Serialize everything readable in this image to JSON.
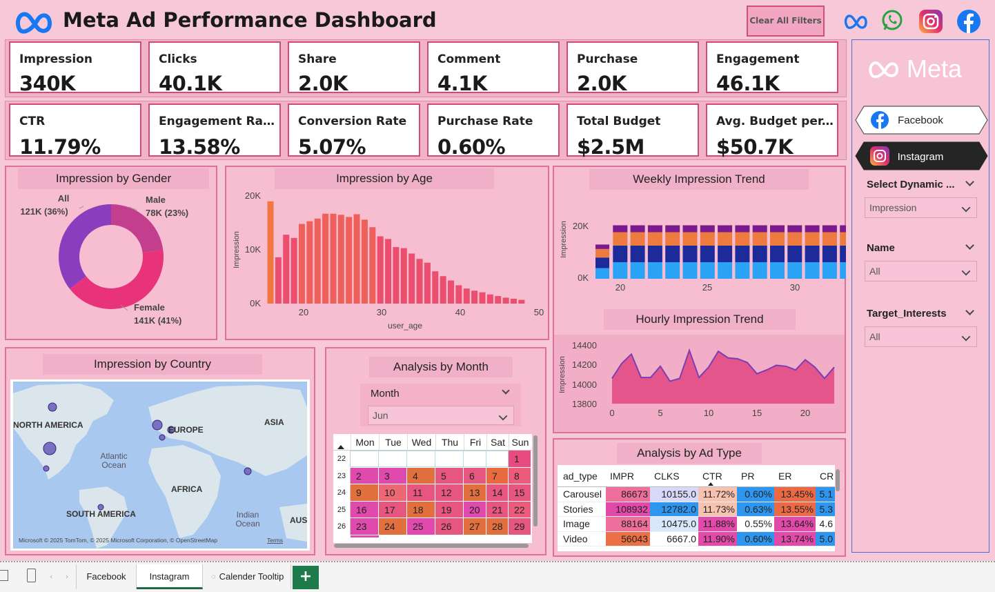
{
  "header": {
    "title": "Meta Ad Performance Dashboard",
    "clear_button": "Clear All Filters"
  },
  "kpis_row1": [
    {
      "label": "Impression",
      "value": "340K"
    },
    {
      "label": "Clicks",
      "value": "40.1K"
    },
    {
      "label": "Share",
      "value": "2.0K"
    },
    {
      "label": "Comment",
      "value": "4.1K"
    },
    {
      "label": "Purchase",
      "value": "2.0K"
    },
    {
      "label": "Engagement",
      "value": "46.1K"
    }
  ],
  "kpis_row2": [
    {
      "label": "CTR",
      "value": "11.79%"
    },
    {
      "label": "Engagement Rate",
      "value": "13.58%"
    },
    {
      "label": "Conversion Rate",
      "value": "5.07%"
    },
    {
      "label": "Purchase Rate",
      "value": "0.60%"
    },
    {
      "label": "Total Budget",
      "value": "$2.5M"
    },
    {
      "label": "Avg. Budget per...",
      "value": "$50.7K"
    }
  ],
  "gender": {
    "title": "Impression by Gender",
    "all_label": "All",
    "all_value": "121K (36%)",
    "male_label": "Male",
    "male_value": "78K (23%)",
    "female_label": "Female",
    "female_value": "141K (41%)"
  },
  "age": {
    "title": "Impression by Age",
    "ylabel": "Impression",
    "xlabel": "user_age",
    "yticks": [
      "20K",
      "10K",
      "0K"
    ],
    "xticks": [
      "20",
      "30",
      "40",
      "50"
    ]
  },
  "weekly": {
    "title": "Weekly Impression Trend",
    "ylabel": "Impression",
    "yticks": [
      "20K",
      "0K"
    ],
    "xticks": [
      "20",
      "25",
      "30"
    ]
  },
  "hourly": {
    "title": "Hourly Impression Trend",
    "ylabel": "Impression",
    "yticks": [
      "14400",
      "14200",
      "14000",
      "13800"
    ],
    "xticks": [
      "0",
      "5",
      "10",
      "15",
      "20"
    ]
  },
  "country": {
    "title": "Impression by Country",
    "labels": {
      "north_america": "NORTH AMERICA",
      "europe": "EUROPE",
      "asia": "ASIA",
      "africa": "AFRICA",
      "south_america": "SOUTH AMERICA",
      "atlantic1": "Atlantic",
      "atlantic2": "Ocean",
      "indian1": "Indian",
      "indian2": "Ocean",
      "aus": "AUS"
    },
    "attribution": "Microsoft © 2025 TomTom, © 2025 Microsoft Corporation, © OpenStreetMap",
    "terms": "Terms"
  },
  "month": {
    "title": "Analysis by Month",
    "filter_label": "Month",
    "filter_value": "Jun",
    "days": [
      "Mon",
      "Tue",
      "Wed",
      "Thu",
      "Fri",
      "Sat",
      "Sun"
    ],
    "weeks": [
      {
        "wk": "22",
        "d": [
          "",
          "",
          "",
          "",
          "",
          "",
          "1"
        ]
      },
      {
        "wk": "23",
        "d": [
          "2",
          "3",
          "4",
          "5",
          "6",
          "7",
          "8"
        ]
      },
      {
        "wk": "24",
        "d": [
          "9",
          "10",
          "11",
          "12",
          "13",
          "14",
          "15"
        ]
      },
      {
        "wk": "25",
        "d": [
          "16",
          "17",
          "18",
          "19",
          "20",
          "21",
          "22"
        ]
      },
      {
        "wk": "26",
        "d": [
          "23",
          "24",
          "25",
          "26",
          "27",
          "28",
          "29"
        ]
      }
    ]
  },
  "adtype": {
    "title": "Analysis by Ad Type",
    "columns": [
      "ad_type",
      "IMPR",
      "CLKS",
      "CTR",
      "PR",
      "ER",
      "CR"
    ],
    "rows": [
      [
        "Carousel",
        "86673",
        "10155.0",
        "11.72%",
        "0.60%",
        "13.45%",
        "5.1"
      ],
      [
        "Stories",
        "108932",
        "12782.0",
        "11.73%",
        "0.63%",
        "13.55%",
        "5.3"
      ],
      [
        "Image",
        "88164",
        "10475.0",
        "11.88%",
        "0.55%",
        "13.64%",
        "4.6"
      ],
      [
        "Video",
        "56043",
        "6667.0",
        "11.90%",
        "0.60%",
        "13.74%",
        "5.0"
      ]
    ]
  },
  "sidebar": {
    "brand": "Meta",
    "facebook": "Facebook",
    "instagram": "Instagram",
    "dyn_label": "Select Dynamic ...",
    "dyn_value": "Impression",
    "name_label": "Name",
    "name_value": "All",
    "ti_label": "Target_Interests",
    "ti_value": "All"
  },
  "tabs": {
    "t1": "Facebook",
    "t2": "Instagram",
    "t3": "Calender Tooltip",
    "add": "+"
  },
  "chart_data": [
    {
      "type": "pie",
      "title": "Impression by Gender",
      "categories": [
        "All",
        "Male",
        "Female"
      ],
      "values": [
        121,
        78,
        141
      ]
    },
    {
      "type": "bar",
      "title": "Impression by Age",
      "xlabel": "user_age",
      "ylabel": "Impression",
      "ylim": [
        0,
        20000
      ],
      "x": [
        18,
        19,
        20,
        21,
        22,
        23,
        24,
        25,
        26,
        27,
        28,
        29,
        30,
        31,
        32,
        33,
        34,
        35,
        36,
        37,
        38,
        39,
        40,
        41,
        42,
        43,
        44,
        45,
        46,
        47,
        48,
        49,
        50
      ],
      "values": [
        19000,
        8600,
        12800,
        12200,
        14800,
        15300,
        15800,
        16700,
        16700,
        16500,
        16100,
        16600,
        15600,
        14200,
        12500,
        12000,
        10500,
        10300,
        9300,
        8300,
        7600,
        6000,
        5100,
        4300,
        3400,
        2800,
        2400,
        2100,
        1700,
        1400,
        1100,
        900,
        700
      ]
    },
    {
      "type": "bar",
      "title": "Weekly Impression Trend",
      "ylabel": "Impression",
      "ylim": [
        0,
        26000
      ],
      "x": [
        18,
        19,
        20,
        21,
        22,
        23,
        24,
        25,
        26,
        27,
        28,
        29,
        30,
        31,
        32,
        33
      ],
      "values": [
        16000,
        25000,
        25000,
        25000,
        25000,
        25000,
        25000,
        25000,
        25000,
        25000,
        25000,
        25000,
        25000,
        25000,
        25000,
        7000
      ]
    },
    {
      "type": "area",
      "title": "Hourly Impression Trend",
      "ylabel": "Impression",
      "ylim": [
        13780,
        14480
      ],
      "x": [
        0,
        1,
        2,
        3,
        4,
        5,
        6,
        7,
        8,
        9,
        10,
        11,
        12,
        13,
        14,
        15,
        16,
        17,
        18,
        19,
        20,
        21,
        22,
        23
      ],
      "values": [
        14050,
        14210,
        14310,
        14060,
        14060,
        14180,
        14020,
        14050,
        14350,
        14060,
        14170,
        14340,
        14270,
        14260,
        14220,
        14100,
        14140,
        14190,
        14180,
        14140,
        14250,
        14170,
        14050,
        14170
      ]
    }
  ]
}
